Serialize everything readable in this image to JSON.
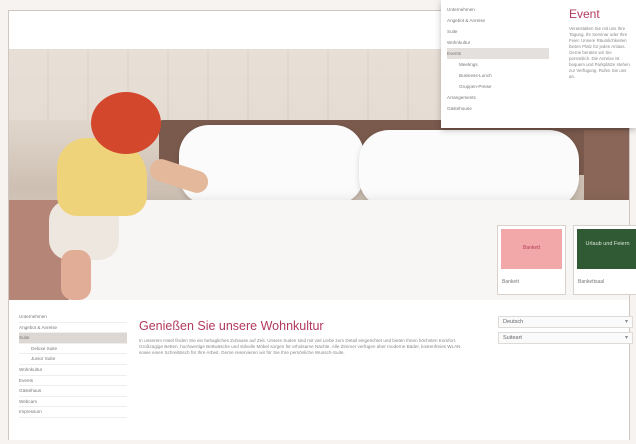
{
  "nav_panel": {
    "items": [
      {
        "label": "Unternehmen",
        "sub": false,
        "active": false
      },
      {
        "label": "Angebot & Anreise",
        "sub": false,
        "active": false
      },
      {
        "label": "Suite",
        "sub": false,
        "active": false
      },
      {
        "label": "Wohnkultur",
        "sub": false,
        "active": false
      },
      {
        "label": "Events",
        "sub": false,
        "active": true
      },
      {
        "label": "Meetings",
        "sub": true,
        "active": false
      },
      {
        "label": "Business-Lunch",
        "sub": true,
        "active": false
      },
      {
        "label": "Gruppen-Preise",
        "sub": true,
        "active": false
      },
      {
        "label": "Arrangements",
        "sub": false,
        "active": false
      },
      {
        "label": "Gästehouse",
        "sub": false,
        "active": false
      }
    ],
    "title": "Event",
    "text": "Veranstalten Sie mit uns Ihre Tagung, Ihr Seminar oder Ihre Feier. Unsere Räumlichkeiten bieten Platz für jeden Anlass. Gerne beraten wir Sie persönlich. Die Anreise ist bequem und Parkplätze stehen zur Verfügung. Rufen Sie uns an."
  },
  "teasers": [
    {
      "image_text": "Bankett",
      "caption": "Bankett"
    },
    {
      "image_text": "Urlaub und Feiern",
      "caption": "Bankettsaal"
    }
  ],
  "left_nav": [
    {
      "label": "Unternehmen",
      "sub": false,
      "active": false
    },
    {
      "label": "Angebot & Anreise",
      "sub": false,
      "active": false
    },
    {
      "label": "Suite",
      "sub": false,
      "active": true
    },
    {
      "label": "Deluxe Suite",
      "sub": true,
      "active": false
    },
    {
      "label": "Junior Suite",
      "sub": true,
      "active": false
    },
    {
      "label": "Wohnkultur",
      "sub": false,
      "active": false
    },
    {
      "label": "Events",
      "sub": false,
      "active": false
    },
    {
      "label": "Gästehaus",
      "sub": false,
      "active": false
    },
    {
      "label": "Webcam",
      "sub": false,
      "active": false
    },
    {
      "label": "Impressum",
      "sub": false,
      "active": false
    }
  ],
  "main": {
    "title": "Genießen Sie unsere Wohnkultur",
    "text": "In unserem Hotel finden Sie ein behagliches Zuhause auf Zeit. Unsere Suiten sind mit viel Liebe zum Detail eingerichtet und bieten Ihnen höchsten Komfort. Großzügige Betten, hochwertige Bettwäsche und stilvolle Möbel sorgen für erholsame Nächte. Alle Zimmer verfügen über moderne Bäder, kostenfreies WLAN sowie einen Schreibtisch für Ihre Arbeit. Gerne reservieren wir für Sie Ihre persönliche Wunsch-Suite."
  },
  "selects": [
    {
      "value": "Deutsch"
    },
    {
      "value": "Suiteart"
    }
  ]
}
